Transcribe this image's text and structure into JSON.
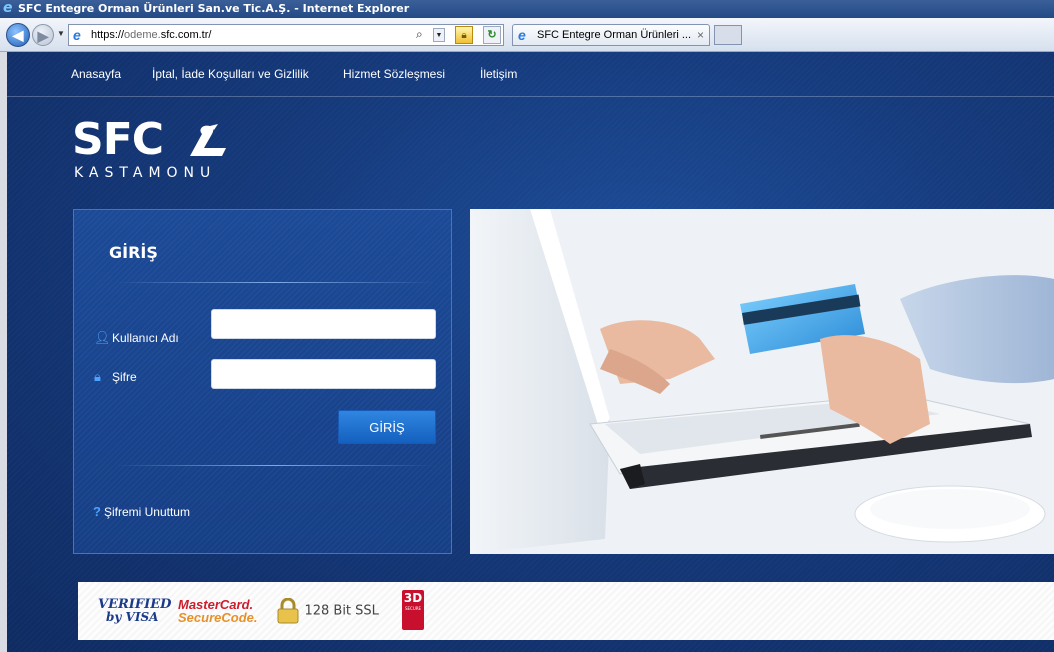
{
  "browser": {
    "window_title": "SFC Entegre Orman Ürünleri San.ve Tic.A.Ş. - Internet Explorer",
    "url_prefix": "https://",
    "url_dim": "odeme.",
    "url_main": "sfc.com.tr",
    "url_suffix": "/",
    "tab_label": "SFC Entegre Orman Ürünleri ...",
    "tab_close": "×"
  },
  "site": {
    "nav": [
      "Anasayfa",
      "İptal, İade Koşulları ve Gizlilik",
      "Hizmet Sözleşmesi",
      "İletişim"
    ],
    "logo_text": "SFC",
    "logo_sub": "KASTAMONU"
  },
  "login": {
    "title": "GİRİŞ",
    "username_label": "Kullanıcı Adı",
    "username_value": "",
    "password_label": "Şifre",
    "password_value": "",
    "submit_label": "GİRİŞ",
    "forgot_label": "Şifremi Unuttum"
  },
  "badges": {
    "verified_line1": "VERIFIED",
    "verified_line2": "by VISA",
    "mastercard_line1": "MasterCard.",
    "mastercard_line2": "SecureCode.",
    "ssl": "128 Bit SSL",
    "secure3d_top": "3D",
    "secure3d_bottom": "SECURE"
  },
  "colors": {
    "page_bg": "#15397a",
    "login_button": "#1f6fd0",
    "accent_icon": "#4ca3ff"
  }
}
